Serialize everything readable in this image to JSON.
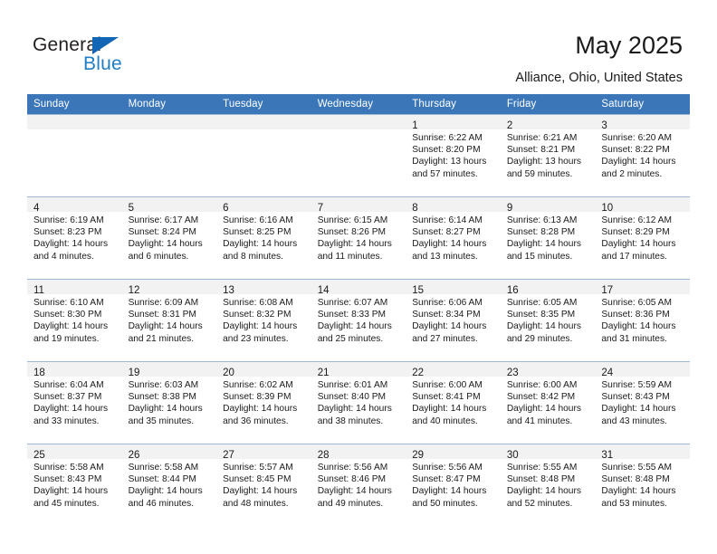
{
  "brand": {
    "name_primary": "General",
    "name_secondary": "Blue",
    "accent_color": "#1266b5",
    "secondary_color": "#1f7ec4"
  },
  "header": {
    "month_title": "May 2025",
    "location": "Alliance, Ohio, United States",
    "header_bg_color": "#3a76b8",
    "daynum_band_color": "#f2f2f2"
  },
  "weekdays": [
    "Sunday",
    "Monday",
    "Tuesday",
    "Wednesday",
    "Thursday",
    "Friday",
    "Saturday"
  ],
  "weeks": [
    [
      {
        "day": "",
        "sunrise": "",
        "sunset": "",
        "daylight_line1": "",
        "daylight_line2": ""
      },
      {
        "day": "",
        "sunrise": "",
        "sunset": "",
        "daylight_line1": "",
        "daylight_line2": ""
      },
      {
        "day": "",
        "sunrise": "",
        "sunset": "",
        "daylight_line1": "",
        "daylight_line2": ""
      },
      {
        "day": "",
        "sunrise": "",
        "sunset": "",
        "daylight_line1": "",
        "daylight_line2": ""
      },
      {
        "day": "1",
        "sunrise": "Sunrise: 6:22 AM",
        "sunset": "Sunset: 8:20 PM",
        "daylight_line1": "Daylight: 13 hours",
        "daylight_line2": "and 57 minutes."
      },
      {
        "day": "2",
        "sunrise": "Sunrise: 6:21 AM",
        "sunset": "Sunset: 8:21 PM",
        "daylight_line1": "Daylight: 13 hours",
        "daylight_line2": "and 59 minutes."
      },
      {
        "day": "3",
        "sunrise": "Sunrise: 6:20 AM",
        "sunset": "Sunset: 8:22 PM",
        "daylight_line1": "Daylight: 14 hours",
        "daylight_line2": "and 2 minutes."
      }
    ],
    [
      {
        "day": "4",
        "sunrise": "Sunrise: 6:19 AM",
        "sunset": "Sunset: 8:23 PM",
        "daylight_line1": "Daylight: 14 hours",
        "daylight_line2": "and 4 minutes."
      },
      {
        "day": "5",
        "sunrise": "Sunrise: 6:17 AM",
        "sunset": "Sunset: 8:24 PM",
        "daylight_line1": "Daylight: 14 hours",
        "daylight_line2": "and 6 minutes."
      },
      {
        "day": "6",
        "sunrise": "Sunrise: 6:16 AM",
        "sunset": "Sunset: 8:25 PM",
        "daylight_line1": "Daylight: 14 hours",
        "daylight_line2": "and 8 minutes."
      },
      {
        "day": "7",
        "sunrise": "Sunrise: 6:15 AM",
        "sunset": "Sunset: 8:26 PM",
        "daylight_line1": "Daylight: 14 hours",
        "daylight_line2": "and 11 minutes."
      },
      {
        "day": "8",
        "sunrise": "Sunrise: 6:14 AM",
        "sunset": "Sunset: 8:27 PM",
        "daylight_line1": "Daylight: 14 hours",
        "daylight_line2": "and 13 minutes."
      },
      {
        "day": "9",
        "sunrise": "Sunrise: 6:13 AM",
        "sunset": "Sunset: 8:28 PM",
        "daylight_line1": "Daylight: 14 hours",
        "daylight_line2": "and 15 minutes."
      },
      {
        "day": "10",
        "sunrise": "Sunrise: 6:12 AM",
        "sunset": "Sunset: 8:29 PM",
        "daylight_line1": "Daylight: 14 hours",
        "daylight_line2": "and 17 minutes."
      }
    ],
    [
      {
        "day": "11",
        "sunrise": "Sunrise: 6:10 AM",
        "sunset": "Sunset: 8:30 PM",
        "daylight_line1": "Daylight: 14 hours",
        "daylight_line2": "and 19 minutes."
      },
      {
        "day": "12",
        "sunrise": "Sunrise: 6:09 AM",
        "sunset": "Sunset: 8:31 PM",
        "daylight_line1": "Daylight: 14 hours",
        "daylight_line2": "and 21 minutes."
      },
      {
        "day": "13",
        "sunrise": "Sunrise: 6:08 AM",
        "sunset": "Sunset: 8:32 PM",
        "daylight_line1": "Daylight: 14 hours",
        "daylight_line2": "and 23 minutes."
      },
      {
        "day": "14",
        "sunrise": "Sunrise: 6:07 AM",
        "sunset": "Sunset: 8:33 PM",
        "daylight_line1": "Daylight: 14 hours",
        "daylight_line2": "and 25 minutes."
      },
      {
        "day": "15",
        "sunrise": "Sunrise: 6:06 AM",
        "sunset": "Sunset: 8:34 PM",
        "daylight_line1": "Daylight: 14 hours",
        "daylight_line2": "and 27 minutes."
      },
      {
        "day": "16",
        "sunrise": "Sunrise: 6:05 AM",
        "sunset": "Sunset: 8:35 PM",
        "daylight_line1": "Daylight: 14 hours",
        "daylight_line2": "and 29 minutes."
      },
      {
        "day": "17",
        "sunrise": "Sunrise: 6:05 AM",
        "sunset": "Sunset: 8:36 PM",
        "daylight_line1": "Daylight: 14 hours",
        "daylight_line2": "and 31 minutes."
      }
    ],
    [
      {
        "day": "18",
        "sunrise": "Sunrise: 6:04 AM",
        "sunset": "Sunset: 8:37 PM",
        "daylight_line1": "Daylight: 14 hours",
        "daylight_line2": "and 33 minutes."
      },
      {
        "day": "19",
        "sunrise": "Sunrise: 6:03 AM",
        "sunset": "Sunset: 8:38 PM",
        "daylight_line1": "Daylight: 14 hours",
        "daylight_line2": "and 35 minutes."
      },
      {
        "day": "20",
        "sunrise": "Sunrise: 6:02 AM",
        "sunset": "Sunset: 8:39 PM",
        "daylight_line1": "Daylight: 14 hours",
        "daylight_line2": "and 36 minutes."
      },
      {
        "day": "21",
        "sunrise": "Sunrise: 6:01 AM",
        "sunset": "Sunset: 8:40 PM",
        "daylight_line1": "Daylight: 14 hours",
        "daylight_line2": "and 38 minutes."
      },
      {
        "day": "22",
        "sunrise": "Sunrise: 6:00 AM",
        "sunset": "Sunset: 8:41 PM",
        "daylight_line1": "Daylight: 14 hours",
        "daylight_line2": "and 40 minutes."
      },
      {
        "day": "23",
        "sunrise": "Sunrise: 6:00 AM",
        "sunset": "Sunset: 8:42 PM",
        "daylight_line1": "Daylight: 14 hours",
        "daylight_line2": "and 41 minutes."
      },
      {
        "day": "24",
        "sunrise": "Sunrise: 5:59 AM",
        "sunset": "Sunset: 8:43 PM",
        "daylight_line1": "Daylight: 14 hours",
        "daylight_line2": "and 43 minutes."
      }
    ],
    [
      {
        "day": "25",
        "sunrise": "Sunrise: 5:58 AM",
        "sunset": "Sunset: 8:43 PM",
        "daylight_line1": "Daylight: 14 hours",
        "daylight_line2": "and 45 minutes."
      },
      {
        "day": "26",
        "sunrise": "Sunrise: 5:58 AM",
        "sunset": "Sunset: 8:44 PM",
        "daylight_line1": "Daylight: 14 hours",
        "daylight_line2": "and 46 minutes."
      },
      {
        "day": "27",
        "sunrise": "Sunrise: 5:57 AM",
        "sunset": "Sunset: 8:45 PM",
        "daylight_line1": "Daylight: 14 hours",
        "daylight_line2": "and 48 minutes."
      },
      {
        "day": "28",
        "sunrise": "Sunrise: 5:56 AM",
        "sunset": "Sunset: 8:46 PM",
        "daylight_line1": "Daylight: 14 hours",
        "daylight_line2": "and 49 minutes."
      },
      {
        "day": "29",
        "sunrise": "Sunrise: 5:56 AM",
        "sunset": "Sunset: 8:47 PM",
        "daylight_line1": "Daylight: 14 hours",
        "daylight_line2": "and 50 minutes."
      },
      {
        "day": "30",
        "sunrise": "Sunrise: 5:55 AM",
        "sunset": "Sunset: 8:48 PM",
        "daylight_line1": "Daylight: 14 hours",
        "daylight_line2": "and 52 minutes."
      },
      {
        "day": "31",
        "sunrise": "Sunrise: 5:55 AM",
        "sunset": "Sunset: 8:48 PM",
        "daylight_line1": "Daylight: 14 hours",
        "daylight_line2": "and 53 minutes."
      }
    ]
  ]
}
